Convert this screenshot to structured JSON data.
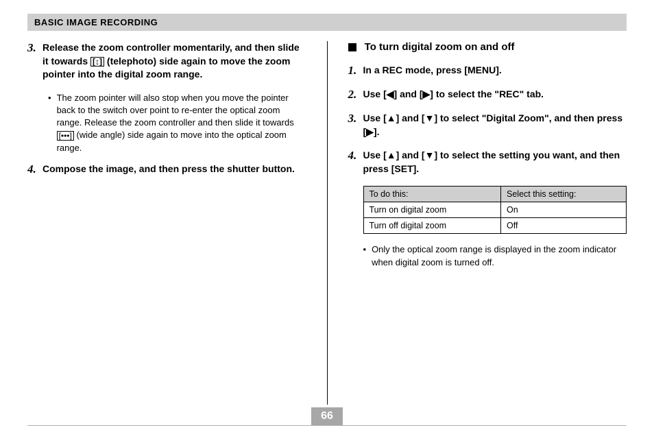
{
  "header": {
    "section_title": "BASIC IMAGE RECORDING"
  },
  "left": {
    "step3": {
      "num": "3.",
      "text_a": "Release the zoom controller momentarily, and then slide it towards ",
      "text_icon": "[↕]",
      "text_b": " (telephoto) side again to move the zoom pointer into the digital zoom range.",
      "bullet_a": "The zoom pointer will also stop when you move the pointer back to the switch over point to re-enter the optical zoom range. Release the zoom controller and then slide it towards ",
      "bullet_icon": "[•••]",
      "bullet_b": " (wide angle) side again to move into the optical zoom range."
    },
    "step4": {
      "num": "4.",
      "text": "Compose the image, and then press the shutter button."
    }
  },
  "right": {
    "heading": "To turn digital zoom on and off",
    "step1": {
      "num": "1.",
      "text": "In a REC mode, press [MENU]."
    },
    "step2": {
      "num": "2.",
      "a": "Use [",
      "arrow_l": "◀",
      "mid": "] and [",
      "arrow_r": "▶",
      "b": "] to select the \"REC\" tab."
    },
    "step3": {
      "num": "3.",
      "a": "Use [",
      "arrow_u": "▲",
      "mid": "] and [",
      "arrow_d": "▼",
      "b": "] to select \"Digital Zoom\", and then press [",
      "arrow_r": "▶",
      "c": "]."
    },
    "step4": {
      "num": "4.",
      "a": "Use [",
      "arrow_u": "▲",
      "mid": "] and [",
      "arrow_d": "▼",
      "b": "] to select the setting you want, and then press [SET]."
    },
    "table": {
      "h1": "To do this:",
      "h2": "Select this setting:",
      "r1c1": "Turn on digital zoom",
      "r1c2": "On",
      "r2c1": "Turn off digital zoom",
      "r2c2": "Off"
    },
    "note": "Only the optical zoom range is displayed in the zoom indicator when digital zoom is turned off."
  },
  "footer": {
    "page": "66"
  }
}
